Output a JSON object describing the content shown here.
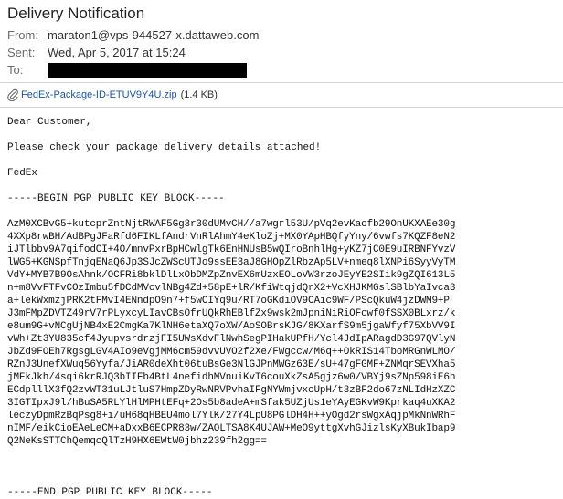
{
  "email": {
    "subject": "Delivery Notification",
    "labels": {
      "from": "From:",
      "sent": "Sent:",
      "to": "To:"
    },
    "from": "maraton1@vps-944527-x.dattaweb.com",
    "sent": "Wed, Apr 5, 2017 at 15:24",
    "to_redacted": true
  },
  "attachment": {
    "icon": "paperclip-icon",
    "name": "FedEx-Package-ID-ETUV9Y4U.zip",
    "size": "(1.4 KB)",
    "link_color": "#1a55b3"
  },
  "body": {
    "greeting": "Dear Customer,",
    "message": "Please check your package delivery details attached!",
    "signature": "FedEx",
    "pgp_begin": "-----BEGIN PGP PUBLIC KEY BLOCK-----",
    "pgp_end": "-----END PGP PUBLIC KEY BLOCK-----",
    "key_lines": [
      "AzM0XCBvG5+kutcprZntNjtRWAF5Gg3r30dUMvCH//a7wgrl53U/pVq2evKaofb29OnUKXAEe30g",
      "4XXp8rwBH/AdBPgJFaRfd6FIKLfAndrVnRlAhmY4eKloZj+MX0YApHBQfyYny/6vwfs7KQZF8eN2",
      "iJTlbbv9A7qifodCI+4O/mnvPxrBpHCwlgTk6EnHNUsB5wQIroBnhlHg+yKZ7jC0E9uIRBNFYvzV",
      "lWG5+KGNSpfTnjqENaQ6Jp3SJcZWScUTJo9ssEE3aJ8GHOpZlRbzAp5LV+nmeq8lXNPi6SyyVyTM",
      "VdY+MYB7B9OsAhnk/OCFRi8bklDlLxObDMZpZnvEX6mUzxEOLoVW3rzoJEyYE2SIik9gZQI613L5",
      "n+m8VvFTFvCOzImbu5fDCdMVcvlNBg4Zd+58pE+lR/KfiWtqjdQrX2+VcXHJKMGslSBlbYaIvca3",
      "a+lekWxmzjPRK2tFMvI4ENndpO9n7+f5wCIYq9u/RT7oGKdiOV9CAic9WF/PScQkuW4jzDWM9+P",
      "J3mFMpZDVTZ49rV7rPLyxcyLIavCBsOfrUQkRhEBlfZx9wsk2mJpniNiRiOFcwf0fSSX0BLxrz/k",
      "e8um9G+vNCgUjNB4xE2CmgKa7KlNH6etaXQ7oXW/AoSOBrsKJG/8KXarfS9m5jgaWfyf75XbVV9I",
      "vWh+Zt3YU835cf4JyupvsrdrzjFI5UWsXdvFlNwhSegPIHakUPfH/Ycl4JdIpARagdD3G97QVlyN",
      "JbZd9FOEh7RgsgLGV4AIo9eVgjMM6cm59dvvUVO2f2Xe/FWgccw/M6q++OkRIS14TboMRGnWLMO/",
      "RZnJ3UnefXWuq56Yyfa/JiAR0deXht06tuBsGe3NlGJPnMWGz63E/sU+47gFGMF+ZNMqrSEVXha5",
      "jMFkJkh/4sqi6krRJQ3bIIFb4BtL4nefidhMVnuiKvT6couXkZsA5gjz6w0/VBYj9sZNp598iE6h",
      "ECdplllX3fQ2zvWT31uLJtluS7HmpZDyRwNRVPvhaIFgNYWmjvxcUpH/t3zBF2do67zNLIdHzXZC",
      "3IGTIpxJ9l/hBuSA5RLYlHlMPHtEFq+2Os5b8adeA+mSfak5UZjUs1eYAyEGKvW9Kprkaq4uXKA2",
      "leczyDpmRzBqPsg8+i/uH68qHBEU4mol7YlK/27Y4LpU8PGlDH4H++yOgd2rsWgxAqjpMkNnWRhF",
      "nIMF/eikCioEAeLeCM+aDxxB6ECPR83w/ZAOLTSA8K4UJAW+MeO9yttgXvhGJizlsKyXBukIbap9",
      "Q2NeKsSTTChQemqcQlTzH9HX6EWtW0jbhz239fh2gg=="
    ]
  }
}
